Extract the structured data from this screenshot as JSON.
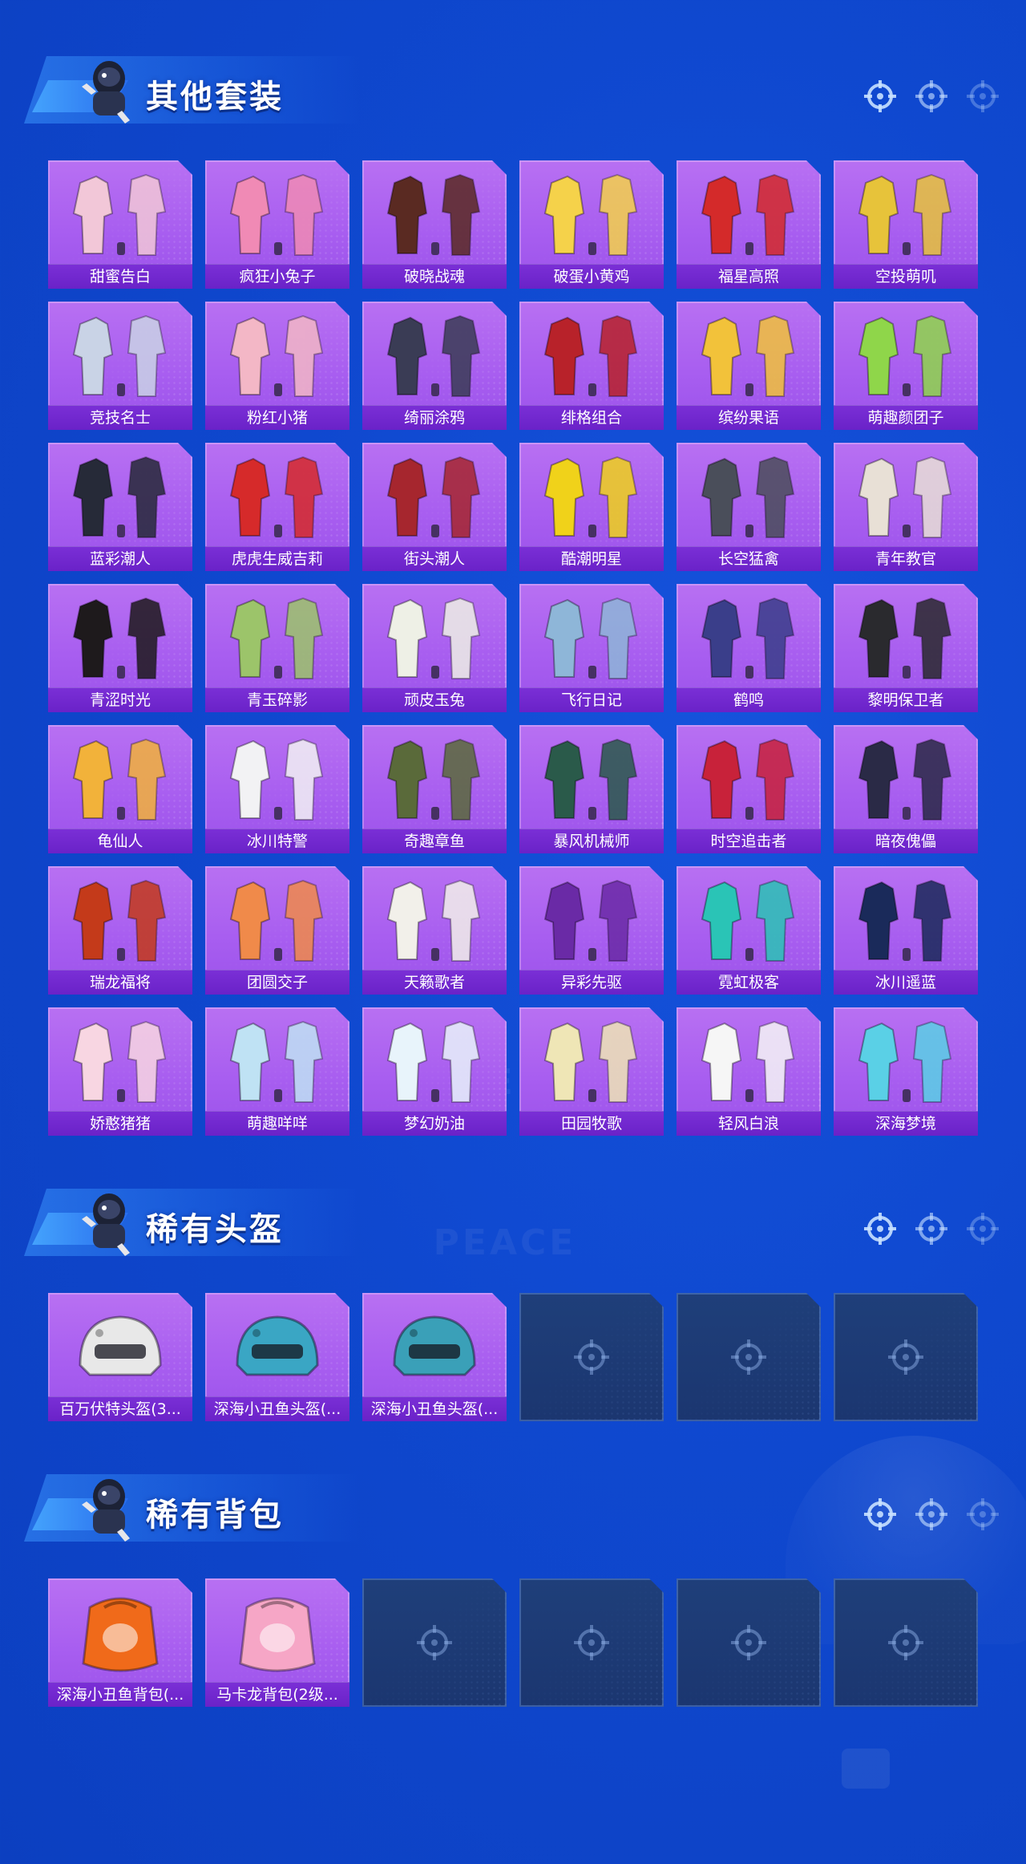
{
  "sections": [
    {
      "id": "outfits",
      "title": "其他套装",
      "items": [
        {
          "label": "甜蜜告白",
          "icon": "outfit-icon",
          "color": "#f2c7d8"
        },
        {
          "label": "疯狂小兔子",
          "icon": "outfit-icon",
          "color": "#f08ab5"
        },
        {
          "label": "破晓战魂",
          "icon": "outfit-icon",
          "color": "#5a2a22"
        },
        {
          "label": "破蛋小黄鸡",
          "icon": "outfit-icon",
          "color": "#f5d24a"
        },
        {
          "label": "福星高照",
          "icon": "outfit-icon",
          "color": "#d42a2a"
        },
        {
          "label": "空投萌叽",
          "icon": "outfit-icon",
          "color": "#e7c33a"
        },
        {
          "label": "竞技名士",
          "icon": "outfit-icon",
          "color": "#c9d3e6"
        },
        {
          "label": "粉红小猪",
          "icon": "outfit-icon",
          "color": "#f3b7c6"
        },
        {
          "label": "绮丽涂鸦",
          "icon": "outfit-icon",
          "color": "#3a3c55"
        },
        {
          "label": "绯格组合",
          "icon": "outfit-icon",
          "color": "#b8222a"
        },
        {
          "label": "缤纷果语",
          "icon": "outfit-icon",
          "color": "#f2c23a"
        },
        {
          "label": "萌趣颜团子",
          "icon": "outfit-icon",
          "color": "#8fd64a"
        },
        {
          "label": "蓝彩潮人",
          "icon": "outfit-icon",
          "color": "#262a38"
        },
        {
          "label": "虎虎生威吉莉",
          "icon": "outfit-icon",
          "color": "#d62a2a"
        },
        {
          "label": "街头潮人",
          "icon": "outfit-icon",
          "color": "#a6262e"
        },
        {
          "label": "酷潮明星",
          "icon": "outfit-icon",
          "color": "#f0d21a"
        },
        {
          "label": "长空猛禽",
          "icon": "outfit-icon",
          "color": "#4a4e5a"
        },
        {
          "label": "青年教官",
          "icon": "outfit-icon",
          "color": "#e8e0d6"
        },
        {
          "label": "青涩时光",
          "icon": "outfit-icon",
          "color": "#1e1a1c"
        },
        {
          "label": "青玉碎影",
          "icon": "outfit-icon",
          "color": "#9cc46a"
        },
        {
          "label": "顽皮玉兔",
          "icon": "outfit-icon",
          "color": "#eef0e6"
        },
        {
          "label": "飞行日记",
          "icon": "outfit-icon",
          "color": "#8eb6d8"
        },
        {
          "label": "鹤鸣",
          "icon": "outfit-icon",
          "color": "#3a3e8a"
        },
        {
          "label": "黎明保卫者",
          "icon": "outfit-icon",
          "color": "#2a2a2e"
        },
        {
          "label": "龟仙人",
          "icon": "outfit-icon",
          "color": "#f2b23a"
        },
        {
          "label": "冰川特警",
          "icon": "outfit-icon",
          "color": "#f2f2f4"
        },
        {
          "label": "奇趣章鱼",
          "icon": "outfit-icon",
          "color": "#5a6a3a"
        },
        {
          "label": "暴风机械师",
          "icon": "outfit-icon",
          "color": "#2a5a4a"
        },
        {
          "label": "时空追击者",
          "icon": "outfit-icon",
          "color": "#c8223a"
        },
        {
          "label": "暗夜傀儡",
          "icon": "outfit-icon",
          "color": "#2a2a46"
        },
        {
          "label": "瑞龙福将",
          "icon": "outfit-icon",
          "color": "#c43a1a"
        },
        {
          "label": "团圆交子",
          "icon": "outfit-icon",
          "color": "#f08a4a"
        },
        {
          "label": "天籁歌者",
          "icon": "outfit-icon",
          "color": "#f2f0ea"
        },
        {
          "label": "异彩先驱",
          "icon": "outfit-icon",
          "color": "#6a2aa6"
        },
        {
          "label": "霓虹极客",
          "icon": "outfit-icon",
          "color": "#2ac4b6"
        },
        {
          "label": "冰川遥蓝",
          "icon": "outfit-icon",
          "color": "#1a2a5a"
        },
        {
          "label": "娇憨猪猪",
          "icon": "outfit-icon",
          "color": "#f8d6e2"
        },
        {
          "label": "萌趣咩咩",
          "icon": "outfit-icon",
          "color": "#bfe2f4"
        },
        {
          "label": "梦幻奶油",
          "icon": "outfit-icon",
          "color": "#e8f4fb"
        },
        {
          "label": "田园牧歌",
          "icon": "outfit-icon",
          "color": "#efe6b6"
        },
        {
          "label": "轻风白浪",
          "icon": "outfit-icon",
          "color": "#f6f6f6"
        },
        {
          "label": "深海梦境",
          "icon": "outfit-icon",
          "color": "#5ad0e6"
        }
      ]
    },
    {
      "id": "helmets",
      "title": "稀有头盔",
      "items": [
        {
          "label": "百万伏特头盔(3...",
          "icon": "helmet-icon",
          "color": "#e8e8e8"
        },
        {
          "label": "深海小丑鱼头盔(...",
          "icon": "helmet-icon",
          "color": "#3aa6c4"
        },
        {
          "label": "深海小丑鱼头盔(...",
          "icon": "helmet-icon",
          "color": "#3aa0b8"
        },
        {
          "empty": true
        },
        {
          "empty": true
        },
        {
          "empty": true
        }
      ]
    },
    {
      "id": "backpacks",
      "title": "稀有背包",
      "items": [
        {
          "label": "深海小丑鱼背包(...",
          "icon": "backpack-icon",
          "color": "#f06a1a"
        },
        {
          "label": "马卡龙背包(2级...",
          "icon": "backpack-icon",
          "color": "#f6a6c6"
        },
        {
          "empty": true
        },
        {
          "empty": true
        },
        {
          "empty": true
        },
        {
          "empty": true
        }
      ]
    }
  ],
  "watermark": "GAME FOR PEACE"
}
